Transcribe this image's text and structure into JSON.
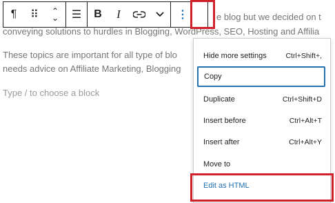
{
  "content": {
    "line1": "e blog but we decided on t",
    "line2": "conveying solutions to hurdles in Blogging, WordPress, SEO, Hosting and Affilia",
    "line3": "These topics are important for all type of blo",
    "line4": "needs advice on Affiliate Marketing, Blogging",
    "placeholder": "Type / to choose a block"
  },
  "toolbar": {
    "paragraph_icon": "¶",
    "drag_icon": "⠿",
    "move_icon": "⌃⌄",
    "align_icon": "☰",
    "bold": "B",
    "italic": "I",
    "link_icon": "⊖",
    "chevron_icon": "⌄",
    "more_icon": "⋮"
  },
  "menu": {
    "items": [
      {
        "label": "Hide more settings",
        "shortcut": "Ctrl+Shift+,"
      },
      {
        "label": "Copy",
        "shortcut": ""
      },
      {
        "label": "Duplicate",
        "shortcut": "Ctrl+Shift+D"
      },
      {
        "label": "Insert before",
        "shortcut": "Ctrl+Alt+T"
      },
      {
        "label": "Insert after",
        "shortcut": "Ctrl+Alt+Y"
      },
      {
        "label": "Move to",
        "shortcut": ""
      },
      {
        "label": "Edit as HTML",
        "shortcut": ""
      }
    ]
  },
  "colors": {
    "accent": "#2271b1",
    "highlight": "#d0212a"
  }
}
